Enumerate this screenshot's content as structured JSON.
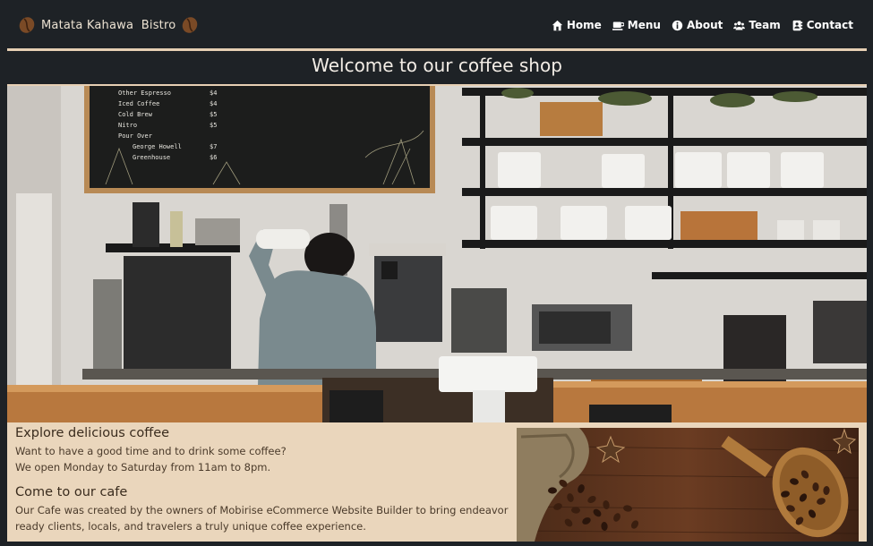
{
  "brand": {
    "name": "Matata Kahawa  Bistro",
    "icon": "coffee-bean-icon"
  },
  "nav": [
    {
      "label": "Home",
      "icon": "home-icon"
    },
    {
      "label": "Menu",
      "icon": "coffee-cup-icon"
    },
    {
      "label": "About",
      "icon": "info-icon"
    },
    {
      "label": "Team",
      "icon": "users-icon"
    },
    {
      "label": "Contact",
      "icon": "contact-card-icon"
    }
  ],
  "hero": {
    "title": "Welcome to our coffee shop"
  },
  "info": {
    "heading1": "Explore delicious coffee",
    "line1": "Want to have a good time and to drink some coffee?",
    "line2": "We open Monday to Saturday from 11am to 8pm.",
    "heading2": "Come to our cafe",
    "paragraph": "Our Cafe was created by the owners of Mobirise eCommerce Website Builder to bring endeavor ready clients, locals, and travelers a truly unique coffee experience."
  },
  "colors": {
    "background": "#1e2226",
    "accent": "#e6cfb3",
    "panel": "#ead6bc"
  },
  "menu_board": [
    [
      "Other Espresso",
      "$4"
    ],
    [
      "Iced Coffee",
      "$4"
    ],
    [
      "Cold Brew",
      "$5"
    ],
    [
      "Nitro",
      "$5"
    ],
    [
      "Pour Over",
      ""
    ],
    [
      "George Howell",
      "$7"
    ],
    [
      "Greenhouse",
      "$6"
    ]
  ]
}
